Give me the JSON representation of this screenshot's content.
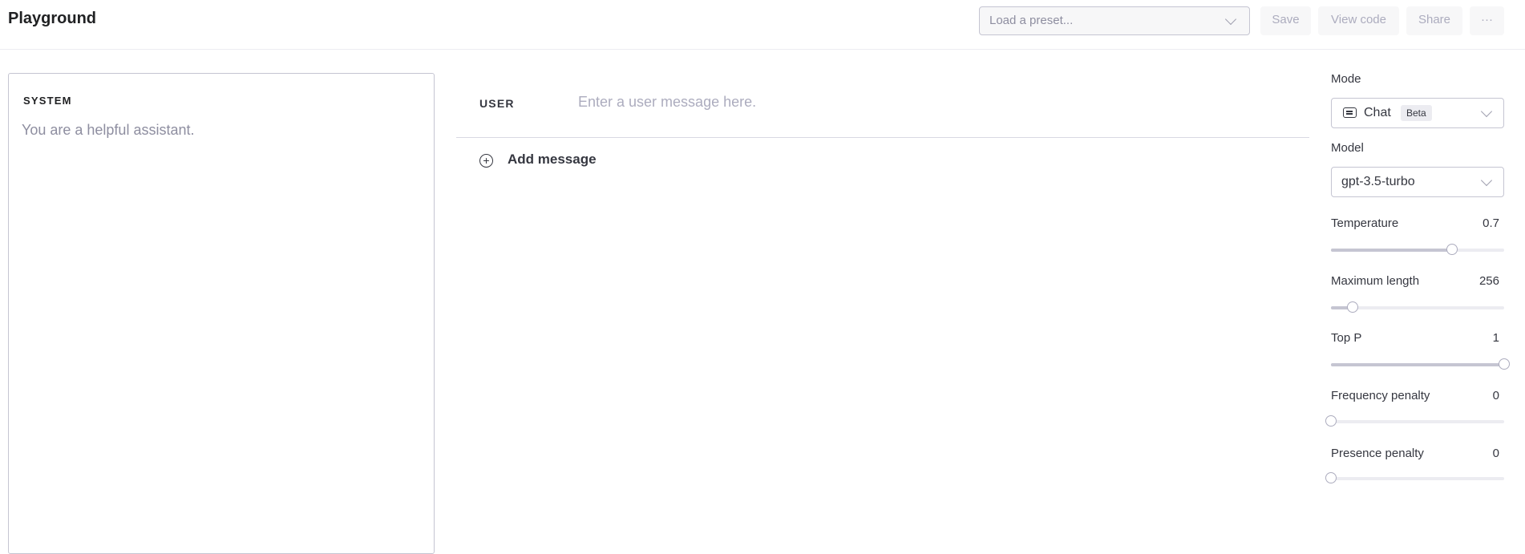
{
  "header": {
    "title": "Playground",
    "preset_placeholder": "Load a preset...",
    "save_label": "Save",
    "view_code_label": "View code",
    "share_label": "Share",
    "more_label": "···"
  },
  "system": {
    "label": "SYSTEM",
    "placeholder": "You are a helpful assistant."
  },
  "messages": {
    "user_label": "USER",
    "user_placeholder": "Enter a user message here.",
    "add_message_label": "Add message",
    "add_icon": "⊕"
  },
  "sidebar": {
    "mode": {
      "label": "Mode",
      "value": "Chat",
      "badge": "Beta",
      "icon": "chat-icon"
    },
    "model": {
      "label": "Model",
      "value": "gpt-3.5-turbo"
    },
    "sliders": [
      {
        "label": "Temperature",
        "value": "0.7",
        "fraction": 0.7
      },
      {
        "label": "Maximum length",
        "value": "256",
        "fraction": 0.125
      },
      {
        "label": "Top P",
        "value": "1",
        "fraction": 1.0
      },
      {
        "label": "Frequency penalty",
        "value": "0",
        "fraction": 0.0
      },
      {
        "label": "Presence penalty",
        "value": "0",
        "fraction": 0.0
      }
    ]
  }
}
